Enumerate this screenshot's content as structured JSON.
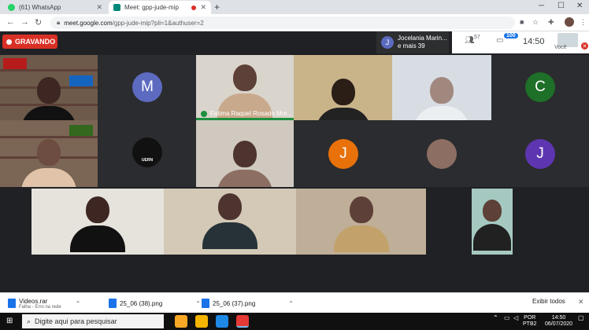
{
  "browser": {
    "tabs": [
      {
        "title": "(61) WhatsApp",
        "icon": "whatsapp-icon",
        "active": false
      },
      {
        "title": "Meet: gpp-jude-mip",
        "icon": "meet-icon",
        "active": true
      }
    ],
    "url_host": "meet.google.com",
    "url_path": "/gpp-jude-mip?pli=1&authuser=2"
  },
  "meet": {
    "recording_label": "GRAVANDO",
    "presenter_initial": "J",
    "presenter_name": "Jocelania Marin...",
    "presenter_more": "e mais 39",
    "participants_count": "57",
    "chat_count": "100",
    "time": "14:50",
    "you_label": "Você",
    "tiles": [
      {
        "initial": "M",
        "color": "#5c6bc0"
      },
      {
        "initial": "C",
        "color": "#1e6f28"
      },
      {
        "initial": "J",
        "color": "#e8710a"
      },
      {
        "initial": "J",
        "color": "#5e35b1"
      }
    ],
    "speaking_name": "Fatima Raquel Rosado Mor...",
    "logo_text": "UERN"
  },
  "downloads": [
    {
      "name": "Videos.rar",
      "status": "Falha - Erro na rede"
    },
    {
      "name": "25_06 (38).png",
      "status": ""
    },
    {
      "name": "25_06 (37).png",
      "status": ""
    }
  ],
  "downloads_show_all": "Exibir todos",
  "taskbar": {
    "search_placeholder": "Digite aqui para pesquisar",
    "lang_1": "POR",
    "lang_2": "PTB2",
    "time": "14:50",
    "date": "06/07/2020"
  }
}
